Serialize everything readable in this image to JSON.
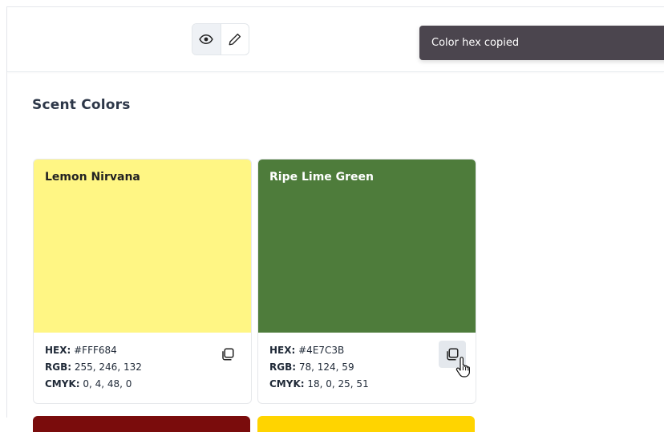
{
  "toolbar": {
    "view_icon": "eye-icon",
    "edit_icon": "pencil-icon",
    "active_mode": "view"
  },
  "toast": {
    "message": "Color hex copied"
  },
  "section": {
    "title": "Scent Colors"
  },
  "cards": [
    {
      "name": "Lemon Nirvana",
      "color": "#FFF684",
      "name_color": "#222222",
      "hex_label": "HEX:",
      "hex": "#FFF684",
      "rgb_label": "RGB:",
      "rgb": "255, 246, 132",
      "cmyk_label": "CMYK:",
      "cmyk": "0, 4, 48, 0"
    },
    {
      "name": "Ripe Lime Green",
      "color": "#4E7C3B",
      "name_color": "#ffffff",
      "hex_label": "HEX:",
      "hex": "#4E7C3B",
      "rgb_label": "RGB:",
      "rgb": "78, 124, 59",
      "cmyk_label": "CMYK:",
      "cmyk": "18, 0, 25, 51"
    }
  ],
  "next_row_colors": [
    "#7a0c0c",
    "#ffd400"
  ]
}
